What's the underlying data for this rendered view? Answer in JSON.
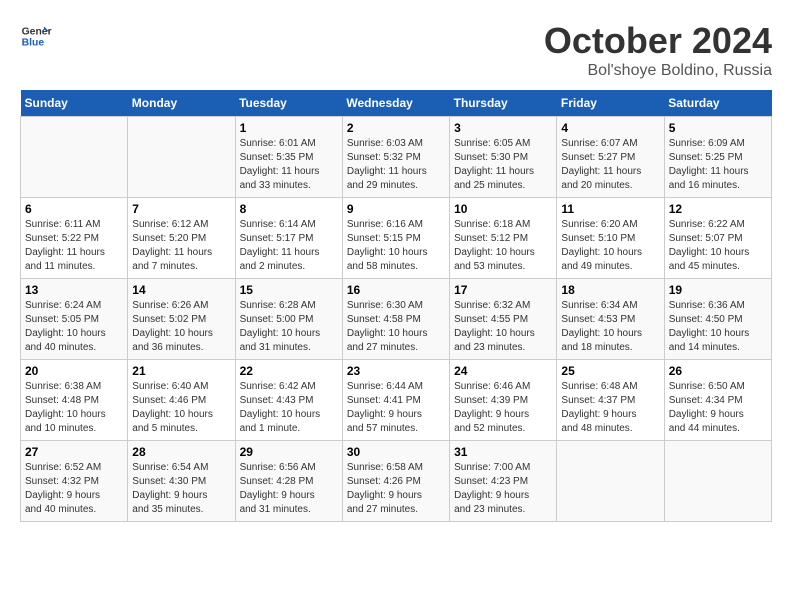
{
  "header": {
    "logo_line1": "General",
    "logo_line2": "Blue",
    "month": "October 2024",
    "location": "Bol'shoye Boldino, Russia"
  },
  "weekdays": [
    "Sunday",
    "Monday",
    "Tuesday",
    "Wednesday",
    "Thursday",
    "Friday",
    "Saturday"
  ],
  "weeks": [
    [
      {
        "day": "",
        "info": ""
      },
      {
        "day": "",
        "info": ""
      },
      {
        "day": "1",
        "info": "Sunrise: 6:01 AM\nSunset: 5:35 PM\nDaylight: 11 hours\nand 33 minutes."
      },
      {
        "day": "2",
        "info": "Sunrise: 6:03 AM\nSunset: 5:32 PM\nDaylight: 11 hours\nand 29 minutes."
      },
      {
        "day": "3",
        "info": "Sunrise: 6:05 AM\nSunset: 5:30 PM\nDaylight: 11 hours\nand 25 minutes."
      },
      {
        "day": "4",
        "info": "Sunrise: 6:07 AM\nSunset: 5:27 PM\nDaylight: 11 hours\nand 20 minutes."
      },
      {
        "day": "5",
        "info": "Sunrise: 6:09 AM\nSunset: 5:25 PM\nDaylight: 11 hours\nand 16 minutes."
      }
    ],
    [
      {
        "day": "6",
        "info": "Sunrise: 6:11 AM\nSunset: 5:22 PM\nDaylight: 11 hours\nand 11 minutes."
      },
      {
        "day": "7",
        "info": "Sunrise: 6:12 AM\nSunset: 5:20 PM\nDaylight: 11 hours\nand 7 minutes."
      },
      {
        "day": "8",
        "info": "Sunrise: 6:14 AM\nSunset: 5:17 PM\nDaylight: 11 hours\nand 2 minutes."
      },
      {
        "day": "9",
        "info": "Sunrise: 6:16 AM\nSunset: 5:15 PM\nDaylight: 10 hours\nand 58 minutes."
      },
      {
        "day": "10",
        "info": "Sunrise: 6:18 AM\nSunset: 5:12 PM\nDaylight: 10 hours\nand 53 minutes."
      },
      {
        "day": "11",
        "info": "Sunrise: 6:20 AM\nSunset: 5:10 PM\nDaylight: 10 hours\nand 49 minutes."
      },
      {
        "day": "12",
        "info": "Sunrise: 6:22 AM\nSunset: 5:07 PM\nDaylight: 10 hours\nand 45 minutes."
      }
    ],
    [
      {
        "day": "13",
        "info": "Sunrise: 6:24 AM\nSunset: 5:05 PM\nDaylight: 10 hours\nand 40 minutes."
      },
      {
        "day": "14",
        "info": "Sunrise: 6:26 AM\nSunset: 5:02 PM\nDaylight: 10 hours\nand 36 minutes."
      },
      {
        "day": "15",
        "info": "Sunrise: 6:28 AM\nSunset: 5:00 PM\nDaylight: 10 hours\nand 31 minutes."
      },
      {
        "day": "16",
        "info": "Sunrise: 6:30 AM\nSunset: 4:58 PM\nDaylight: 10 hours\nand 27 minutes."
      },
      {
        "day": "17",
        "info": "Sunrise: 6:32 AM\nSunset: 4:55 PM\nDaylight: 10 hours\nand 23 minutes."
      },
      {
        "day": "18",
        "info": "Sunrise: 6:34 AM\nSunset: 4:53 PM\nDaylight: 10 hours\nand 18 minutes."
      },
      {
        "day": "19",
        "info": "Sunrise: 6:36 AM\nSunset: 4:50 PM\nDaylight: 10 hours\nand 14 minutes."
      }
    ],
    [
      {
        "day": "20",
        "info": "Sunrise: 6:38 AM\nSunset: 4:48 PM\nDaylight: 10 hours\nand 10 minutes."
      },
      {
        "day": "21",
        "info": "Sunrise: 6:40 AM\nSunset: 4:46 PM\nDaylight: 10 hours\nand 5 minutes."
      },
      {
        "day": "22",
        "info": "Sunrise: 6:42 AM\nSunset: 4:43 PM\nDaylight: 10 hours\nand 1 minute."
      },
      {
        "day": "23",
        "info": "Sunrise: 6:44 AM\nSunset: 4:41 PM\nDaylight: 9 hours\nand 57 minutes."
      },
      {
        "day": "24",
        "info": "Sunrise: 6:46 AM\nSunset: 4:39 PM\nDaylight: 9 hours\nand 52 minutes."
      },
      {
        "day": "25",
        "info": "Sunrise: 6:48 AM\nSunset: 4:37 PM\nDaylight: 9 hours\nand 48 minutes."
      },
      {
        "day": "26",
        "info": "Sunrise: 6:50 AM\nSunset: 4:34 PM\nDaylight: 9 hours\nand 44 minutes."
      }
    ],
    [
      {
        "day": "27",
        "info": "Sunrise: 6:52 AM\nSunset: 4:32 PM\nDaylight: 9 hours\nand 40 minutes."
      },
      {
        "day": "28",
        "info": "Sunrise: 6:54 AM\nSunset: 4:30 PM\nDaylight: 9 hours\nand 35 minutes."
      },
      {
        "day": "29",
        "info": "Sunrise: 6:56 AM\nSunset: 4:28 PM\nDaylight: 9 hours\nand 31 minutes."
      },
      {
        "day": "30",
        "info": "Sunrise: 6:58 AM\nSunset: 4:26 PM\nDaylight: 9 hours\nand 27 minutes."
      },
      {
        "day": "31",
        "info": "Sunrise: 7:00 AM\nSunset: 4:23 PM\nDaylight: 9 hours\nand 23 minutes."
      },
      {
        "day": "",
        "info": ""
      },
      {
        "day": "",
        "info": ""
      }
    ]
  ]
}
